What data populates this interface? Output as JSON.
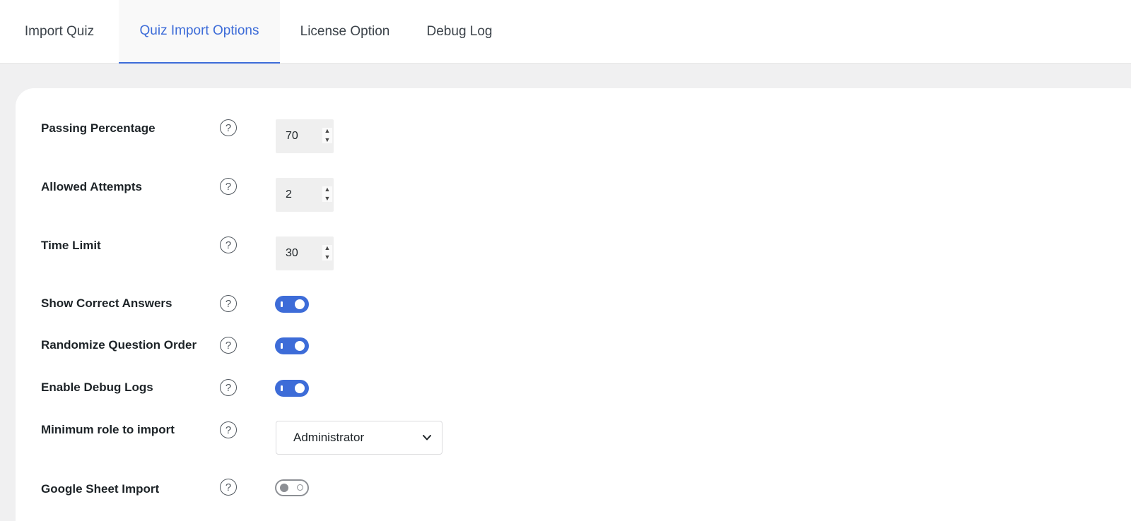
{
  "tabs": [
    {
      "label": "Import Quiz"
    },
    {
      "label": "Quiz Import Options"
    },
    {
      "label": "License Option"
    },
    {
      "label": "Debug Log"
    }
  ],
  "active_tab": "Quiz Import Options",
  "settings": {
    "passing_percentage": {
      "label": "Passing Percentage",
      "value": "70"
    },
    "allowed_attempts": {
      "label": "Allowed Attempts",
      "value": "2"
    },
    "time_limit": {
      "label": "Time Limit",
      "value": "30"
    },
    "show_correct_answers": {
      "label": "Show Correct Answers",
      "enabled": true
    },
    "randomize_question_order": {
      "label": "Randomize Question Order",
      "enabled": true
    },
    "enable_debug_logs": {
      "label": "Enable Debug Logs",
      "enabled": true
    },
    "minimum_role": {
      "label": "Minimum role to import",
      "value": "Administrator"
    },
    "google_sheet_import": {
      "label": "Google Sheet Import",
      "enabled": false
    }
  },
  "help_glyph": "?",
  "colors": {
    "accent": "#3d6cd8",
    "background": "#f0f0f1",
    "toggle_off": "#8c8f94"
  },
  "icons": {
    "help": "question-circle-icon",
    "chevron": "chevron-down-icon",
    "spinner": "spinner-arrows-icon"
  }
}
